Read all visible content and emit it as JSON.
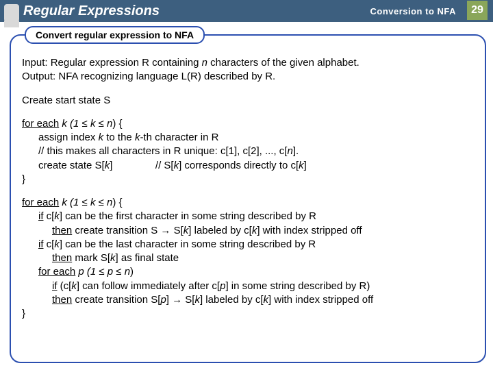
{
  "header": {
    "title": "Regular Expressions",
    "subtitle": "Conversion to NFA",
    "page": "29"
  },
  "section_label": "Convert regular expression to NFA",
  "intro": {
    "input_prefix": "Input: Regular expression R containing ",
    "input_n": "n",
    "input_suffix": " characters of the given alphabet.",
    "output": "Output: NFA recognizing language L(R) described by R."
  },
  "create_start": "Create start state S",
  "loop1": {
    "hdr_prefix": "for each",
    "hdr_mid": " k (1 ≤ k ≤ n",
    "hdr_suffix": ") {",
    "l1a": "assign index ",
    "l1b": "k",
    "l1c": "  to the ",
    "l1d": "k",
    "l1e": "-th character in R",
    "l2a": "// this makes all characters in R unique: c[1], c[2], ..., c[",
    "l2b": "n",
    "l2c": "].",
    "l3a": "create state S[",
    "l3b": "k",
    "l3c": "]",
    "l3gap": "               ",
    "l3d": "// S[",
    "l3e": "k",
    "l3f": "] corresponds directly to c[",
    "l3g": "k",
    "l3h": "]",
    "close": "}"
  },
  "loop2": {
    "hdr_prefix": "for each",
    "hdr_mid": " k (1 ≤ k ≤ n",
    "hdr_suffix": ") {",
    "l1a": "if",
    "l1b": " c[",
    "l1c": "k",
    "l1d": "] can be the first character in some string described by R",
    "l2a": "then",
    "l2b": " create transition S → S[",
    "l2c": "k",
    "l2d": "]  labeled by c[",
    "l2e": "k",
    "l2f": "] with index stripped off",
    "l3a": "if",
    "l3b": " c[",
    "l3c": "k",
    "l3d": "] can be the last character in some string described by R",
    "l4a": "then",
    "l4b": " mark S[",
    "l4c": "k",
    "l4d": "] as final state",
    "l5a": "for  each",
    "l5b": " p (1 ≤ p ≤ n",
    "l5c": ")",
    "l6a": "if",
    "l6b": " (c[",
    "l6c": "k",
    "l6d": "] can follow immediately after c[",
    "l6e": "p",
    "l6f": "] in some string described by R)",
    "l7a": "then",
    "l7b": " create transition S[",
    "l7c": "p",
    "l7d": "] → S[",
    "l7e": "k",
    "l7f": "]  labeled by c[",
    "l7g": "k",
    "l7h": "] with index stripped off",
    "close": "}"
  }
}
